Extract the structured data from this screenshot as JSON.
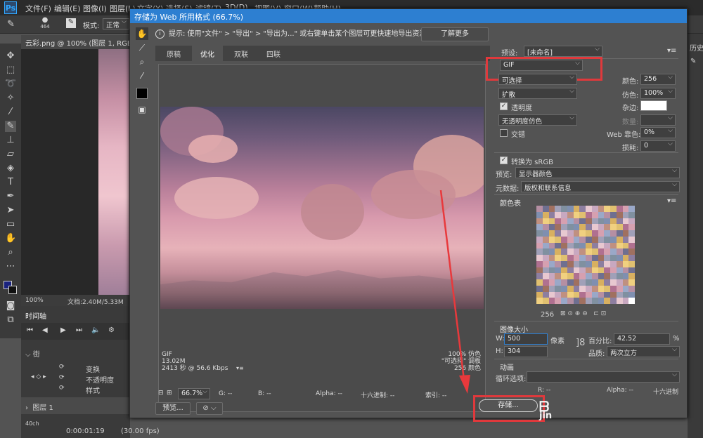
{
  "menubar": {
    "items": [
      "文件(F)",
      "编辑(E)",
      "图像(I)",
      "图层(L)",
      "文字(Y)",
      "选择(S)",
      "滤镜(T)",
      "3D(D)",
      "视图(V)",
      "窗口(W)",
      "帮助(H)"
    ]
  },
  "optbar": {
    "brush_size": "464",
    "mode_label": "模式:",
    "mode_value": "正常"
  },
  "document": {
    "tab_title": "云彩.png @ 100% (图层 1, RGB/8)",
    "zoom": "100%",
    "doc_size": "文档:2.40M/5.33M"
  },
  "timeline": {
    "title": "时间轴",
    "track": "街",
    "rows": [
      "变换",
      "不透明度",
      "样式"
    ],
    "layer": "图层 1",
    "timecode": "0:00:01:19",
    "fps": "(30.00 fps)",
    "small_label": "40ch"
  },
  "right_panel": {
    "label": "历史"
  },
  "dialog": {
    "title": "存储为 Web 所用格式 (66.7%)",
    "hint": "提示: 使用\"文件\" > \"导出\" > \"导出为...\" 或右键单击某个图层可更快速地导出资源",
    "learn_more": "了解更多",
    "tabs": [
      "原稿",
      "优化",
      "双联",
      "四联"
    ],
    "active_tab": "优化",
    "preview_info_left": [
      "GIF",
      "13.02M",
      "2413 秒 @ 56.6 Kbps"
    ],
    "preview_info_right": [
      "100% 仿色",
      "\"可选择\" 调板",
      "256 颜色"
    ],
    "bottom": {
      "zoom": "66.7%",
      "g": "G: --",
      "b": "B: --",
      "alpha": "Alpha: --",
      "hex": "十六进制: --",
      "index": "索引: --"
    },
    "preview_button": "预览...",
    "save_button": "存储...",
    "watermark": "jin",
    "settings": {
      "preset_label": "预设:",
      "preset_value": "[未命名]",
      "format": "GIF",
      "reduction": "可选择",
      "dither_algo": "扩散",
      "transparency_label": "透明度",
      "transparency_dither": "无透明度仿色",
      "interlaced_label": "交错",
      "colors_label": "颜色:",
      "colors_value": "256",
      "dither_label": "仿色:",
      "dither_value": "100%",
      "matte_label": "杂边:",
      "amount_label": "数量:",
      "web_snap_label": "Web 靠色:",
      "web_snap_value": "0%",
      "lossy_label": "损耗:",
      "lossy_value": "0",
      "convert_srgb": "转换为 sRGB",
      "preview_label": "预览:",
      "preview_value": "显示器颜色",
      "metadata_label": "元数据:",
      "metadata_value": "版权和联系信息",
      "color_table_label": "颜色表",
      "color_count": "256",
      "image_size_label": "图像大小",
      "w_label": "W:",
      "w_value": "500",
      "h_label": "H:",
      "h_value": "304",
      "px": "像素",
      "percent_label": "百分比:",
      "percent_value": "42.52",
      "percent_unit": "%",
      "quality_label": "品质:",
      "quality_value": "两次立方",
      "animation_label": "动画",
      "loop_label": "循环选项:",
      "bottom_r": "R: --",
      "bottom_alpha": "Alpha: --",
      "bottom_hex": "十六进制"
    }
  },
  "colors": {
    "accent": "#2d7fd1",
    "highlight": "#e0393c",
    "arrow": "#e8393c"
  }
}
